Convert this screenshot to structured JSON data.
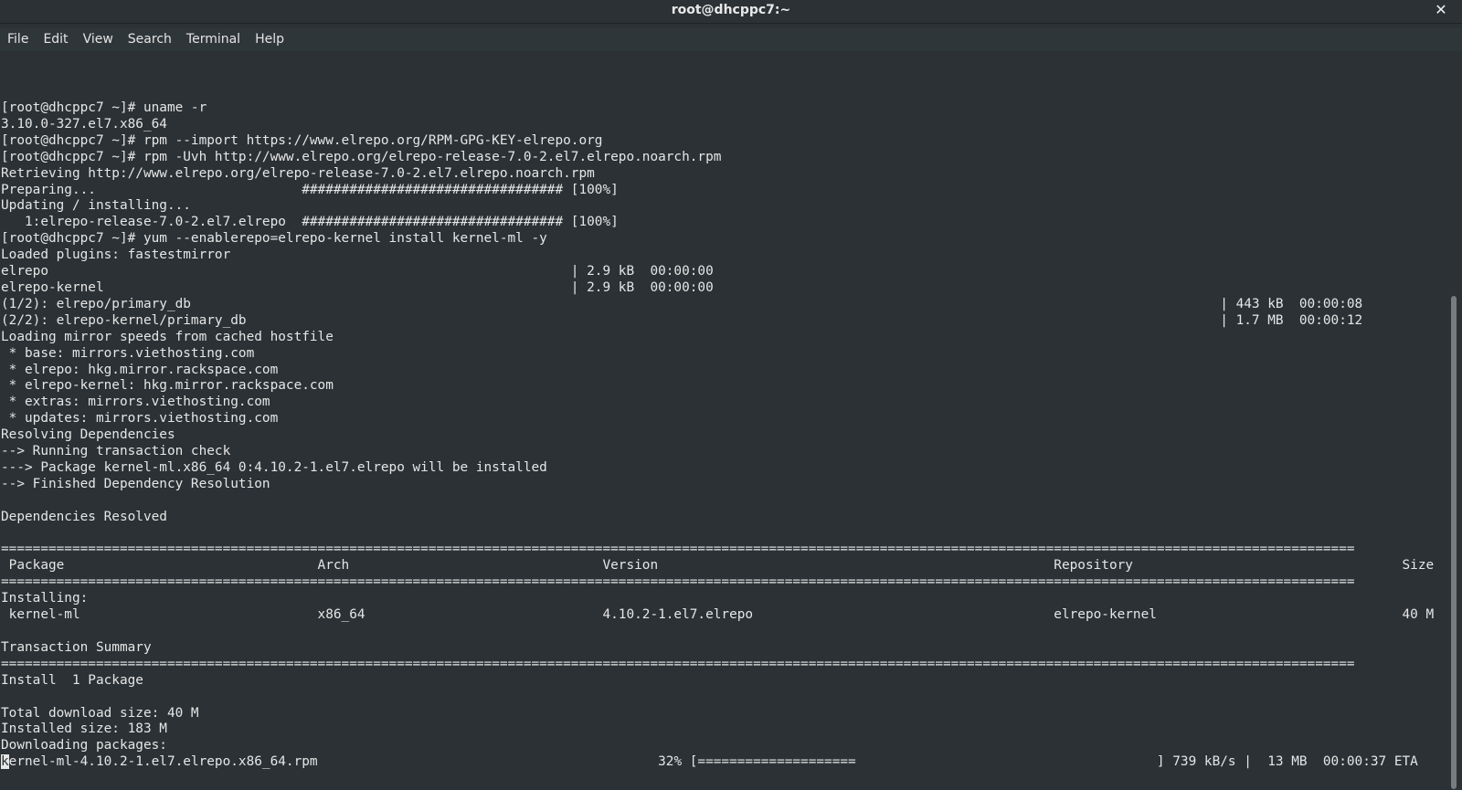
{
  "window": {
    "title": "root@dhcppc7:~",
    "close_glyph": "✕"
  },
  "menu": {
    "items": [
      "File",
      "Edit",
      "View",
      "Search",
      "Terminal",
      "Help"
    ]
  },
  "terminal": {
    "lines": [
      "[root@dhcppc7 ~]# uname -r",
      "3.10.0-327.el7.x86_64",
      "[root@dhcppc7 ~]# rpm --import https://www.elrepo.org/RPM-GPG-KEY-elrepo.org",
      "[root@dhcppc7 ~]# rpm -Uvh http://www.elrepo.org/elrepo-release-7.0-2.el7.elrepo.noarch.rpm",
      "Retrieving http://www.elrepo.org/elrepo-release-7.0-2.el7.elrepo.noarch.rpm",
      "Preparing...                          ################################# [100%]",
      "Updating / installing...",
      "   1:elrepo-release-7.0-2.el7.elrepo  ################################# [100%]",
      "[root@dhcppc7 ~]# yum --enablerepo=elrepo-kernel install kernel-ml -y",
      "Loaded plugins: fastestmirror",
      "elrepo                                                                  | 2.9 kB  00:00:00",
      "elrepo-kernel                                                           | 2.9 kB  00:00:00",
      "(1/2): elrepo/primary_db                                                                                                                                  | 443 kB  00:00:08",
      "(2/2): elrepo-kernel/primary_db                                                                                                                           | 1.7 MB  00:00:12",
      "Loading mirror speeds from cached hostfile",
      " * base: mirrors.viethosting.com",
      " * elrepo: hkg.mirror.rackspace.com",
      " * elrepo-kernel: hkg.mirror.rackspace.com",
      " * extras: mirrors.viethosting.com",
      " * updates: mirrors.viethosting.com",
      "Resolving Dependencies",
      "--> Running transaction check",
      "---> Package kernel-ml.x86_64 0:4.10.2-1.el7.elrepo will be installed",
      "--> Finished Dependency Resolution",
      "",
      "Dependencies Resolved",
      "",
      "===========================================================================================================================================================================",
      " Package                                Arch                                Version                                                  Repository                                  Size",
      "===========================================================================================================================================================================",
      "Installing:",
      " kernel-ml                              x86_64                              4.10.2-1.el7.elrepo                                      elrepo-kernel                               40 M",
      "",
      "Transaction Summary",
      "===========================================================================================================================================================================",
      "Install  1 Package",
      "",
      "Total download size: 40 M",
      "Installed size: 183 M",
      "Downloading packages:"
    ],
    "progress_line": {
      "cursor_char": "k",
      "rest": "ernel-ml-4.10.2-1.el7.elrepo.x86_64.rpm                                           32% [====================                                      ] 739 kB/s |  13 MB  00:00:37 ETA"
    },
    "download_progress_fraction": 0.32
  },
  "colors": {
    "background": "#2b3135",
    "foreground": "#e6e6e6",
    "menubar": "#2f363a"
  }
}
